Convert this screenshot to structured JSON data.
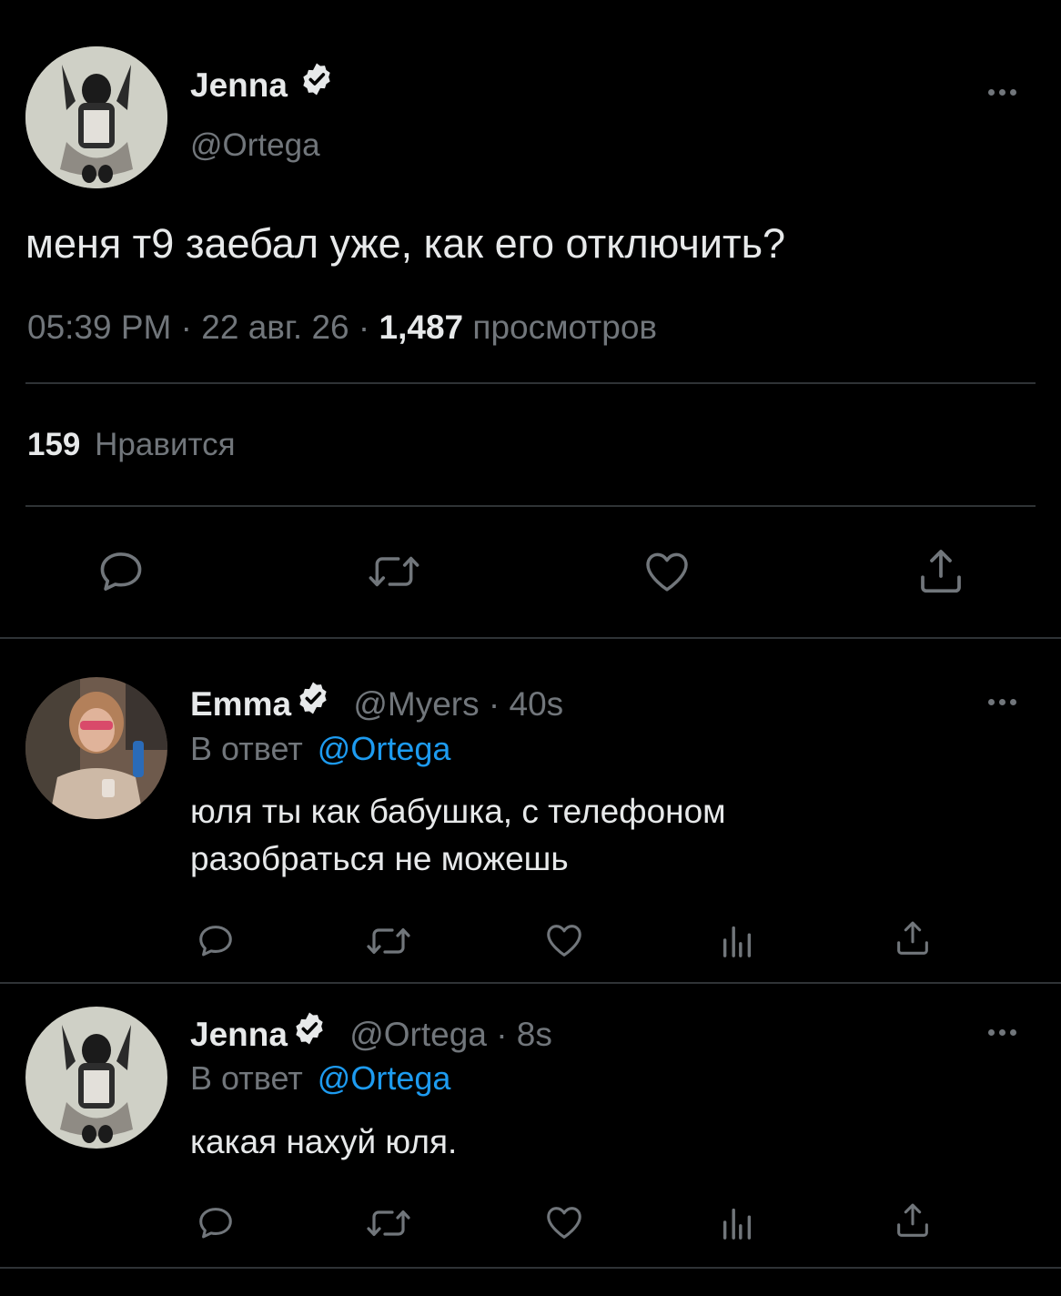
{
  "main_tweet": {
    "display_name": "Jenna",
    "handle": "@Ortega",
    "text": "меня т9 заебал уже, как его отключить?",
    "time": "05:39 PM",
    "sep1": "·",
    "date": "22 авг. 26",
    "sep2": "·",
    "views_count": "1,487",
    "views_label": "просмотров",
    "likes_count": "159",
    "likes_label": "Нравится"
  },
  "replies": [
    {
      "display_name": "Emma",
      "handle": "@Myers",
      "time": "· 40s",
      "reply_prefix": "В ответ",
      "reply_to": "@Ortega",
      "text_line1": "юля ты как бабушка, с телефоном",
      "text_line2": "разобраться не можешь"
    },
    {
      "display_name": "Jenna",
      "handle": "@Ortega",
      "time": "· 8s",
      "reply_prefix": "В ответ",
      "reply_to": "@Ortega",
      "text_line1": "какая нахуй юля."
    }
  ],
  "icons": {
    "verified": "verified-badge-icon",
    "reply": "reply-icon",
    "retweet": "retweet-icon",
    "like": "heart-icon",
    "views": "views-icon",
    "share": "share-icon",
    "more": "more-icon"
  },
  "colors": {
    "background": "#000000",
    "text": "#e7e9ea",
    "muted": "#71767b",
    "link": "#1d9bf0",
    "divider": "#2f3336"
  }
}
